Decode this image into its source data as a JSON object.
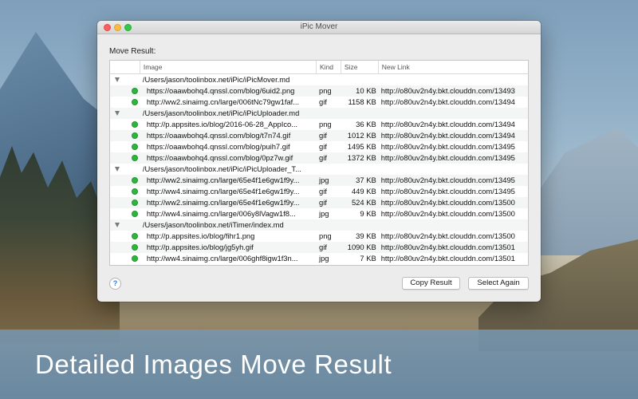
{
  "window": {
    "title": "iPic Mover"
  },
  "section_label": "Move Result:",
  "table": {
    "columns": [
      "Image",
      "Kind",
      "Size",
      "New Link"
    ],
    "rows": [
      {
        "type": "group",
        "image": "/Users/jason/toolinbox.net/iPic/iPicMover.md"
      },
      {
        "type": "item",
        "image": "https://oaawbohq4.qnssl.com/blog/6uid2.png",
        "kind": "png",
        "size": "10 KB",
        "link": "http://o80uv2n4y.bkt.clouddn.com/13493"
      },
      {
        "type": "item",
        "image": "http://ww2.sinaimg.cn/large/006tNc79gw1faf...",
        "kind": "gif",
        "size": "1158 KB",
        "link": "http://o80uv2n4y.bkt.clouddn.com/13494"
      },
      {
        "type": "group",
        "image": "/Users/jason/toolinbox.net/iPic/iPicUploader.md"
      },
      {
        "type": "item",
        "image": "http://p.appsites.io/blog/2016-06-28_AppIco...",
        "kind": "png",
        "size": "36 KB",
        "link": "http://o80uv2n4y.bkt.clouddn.com/13494"
      },
      {
        "type": "item",
        "image": "https://oaawbohq4.qnssl.com/blog/t7n74.gif",
        "kind": "gif",
        "size": "1012 KB",
        "link": "http://o80uv2n4y.bkt.clouddn.com/13494"
      },
      {
        "type": "item",
        "image": "https://oaawbohq4.qnssl.com/blog/puih7.gif",
        "kind": "gif",
        "size": "1495 KB",
        "link": "http://o80uv2n4y.bkt.clouddn.com/13495"
      },
      {
        "type": "item",
        "image": "https://oaawbohq4.qnssl.com/blog/0pz7w.gif",
        "kind": "gif",
        "size": "1372 KB",
        "link": "http://o80uv2n4y.bkt.clouddn.com/13495"
      },
      {
        "type": "group",
        "image": "/Users/jason/toolinbox.net/iPic/iPicUploader_T..."
      },
      {
        "type": "item",
        "image": "http://ww2.sinaimg.cn/large/65e4f1e6gw1f9y...",
        "kind": "jpg",
        "size": "37 KB",
        "link": "http://o80uv2n4y.bkt.clouddn.com/13495"
      },
      {
        "type": "item",
        "image": "http://ww4.sinaimg.cn/large/65e4f1e6gw1f9y...",
        "kind": "gif",
        "size": "449 KB",
        "link": "http://o80uv2n4y.bkt.clouddn.com/13495"
      },
      {
        "type": "item",
        "image": "http://ww2.sinaimg.cn/large/65e4f1e6gw1f9y...",
        "kind": "gif",
        "size": "524 KB",
        "link": "http://o80uv2n4y.bkt.clouddn.com/13500"
      },
      {
        "type": "item",
        "image": "http://ww4.sinaimg.cn/large/006y8lVagw1f8...",
        "kind": "jpg",
        "size": "9 KB",
        "link": "http://o80uv2n4y.bkt.clouddn.com/13500"
      },
      {
        "type": "group",
        "image": "/Users/jason/toolinbox.net/iTimer/index.md"
      },
      {
        "type": "item",
        "image": "http://p.appsites.io/blog/fihr1.png",
        "kind": "png",
        "size": "39 KB",
        "link": "http://o80uv2n4y.bkt.clouddn.com/13500"
      },
      {
        "type": "item",
        "image": "http://p.appsites.io/blog/jg5yh.gif",
        "kind": "gif",
        "size": "1090 KB",
        "link": "http://o80uv2n4y.bkt.clouddn.com/13501"
      },
      {
        "type": "item",
        "image": "http://ww4.sinaimg.cn/large/006ghf8igw1f3n...",
        "kind": "jpg",
        "size": "7 KB",
        "link": "http://o80uv2n4y.bkt.clouddn.com/13501"
      }
    ]
  },
  "help_label": "?",
  "buttons": {
    "copy_result": "Copy Result",
    "select_again": "Select Again"
  },
  "caption": "Detailed Images Move Result",
  "colors": {
    "status_ok": "#2fb53e",
    "close": "#fc605c",
    "minimize": "#fdbc40",
    "maximize": "#34c84a"
  }
}
